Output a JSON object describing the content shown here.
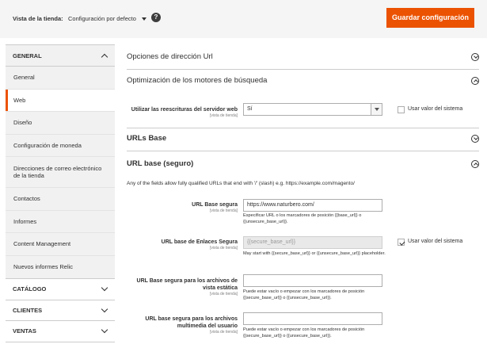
{
  "header": {
    "scope_label": "Vista de la tienda:",
    "scope_value": "Configuración por defecto",
    "help_symbol": "?",
    "save_label": "Guardar configuración",
    "accent": "#eb5202"
  },
  "sidebar": {
    "general_title": "GENERAL",
    "items": [
      "General",
      "Web",
      "Diseño",
      "Configuración de moneda",
      "Direcciones de correo electrónico de la tienda",
      "Contactos",
      "Informes",
      "Content Management",
      "Nuevos informes Relic"
    ],
    "active_item": "Web",
    "collapsed_groups": [
      "CATÁLOGO",
      "CLIENTES",
      "VENTAS"
    ]
  },
  "main": {
    "sections": {
      "url_options": "Opciones de dirección Url",
      "seo": "Optimización de los motores de búsqueda",
      "urls_base": "URLs Base",
      "urls_secure": "URL base (seguro)"
    },
    "seo_field": {
      "label": "Utilizar las reescrituras del servidor web",
      "scope": "[vista de tienda]",
      "value": "Sí",
      "use_system_label": "Usar valor del sistema",
      "use_system_checked": false
    },
    "secure_intro": "Any of the fields allow fully qualified URLs that end with '/' (slash) e.g. https://example.com/magento/",
    "fields": [
      {
        "label": "URL Base segura",
        "scope": "[vista de tienda]",
        "value": "https://www.naturbero.com/",
        "note": "Especificar URL o los marcadores de posición {{base_url}} o {{unsecure_base_url}}."
      },
      {
        "label": "URL base de Enlaces Segura",
        "scope": "[vista de tienda]",
        "value": "{{secure_base_url}}",
        "note": "May start with {{secure_base_url}} or {{unsecure_base_url}} placeholder.",
        "use_system_label": "Usar valor del sistema",
        "use_system_checked": true
      },
      {
        "label": "URL Base segura para los archivos de vista estática",
        "scope": "[vista de tienda]",
        "value": "",
        "note": "Puede estar vacío o empezar con los marcadores de posición {{secure_base_url}} o {{unsecure_base_url}}."
      },
      {
        "label": "URL base segura para los archivos multimedia del usuario",
        "scope": "[vista de tienda]",
        "value": "",
        "note": "Puede estar vacío o empezar con los marcadores de posición {{secure_base_url}} o {{unsecure_base_url}}."
      }
    ]
  }
}
